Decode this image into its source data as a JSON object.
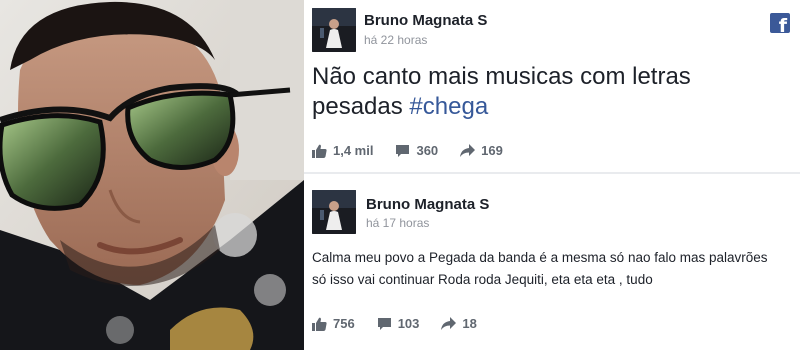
{
  "posts": [
    {
      "author": "Bruno Magnata S",
      "time": "há 22 horas",
      "text": "Não canto mais musicas com letras pesadas",
      "hashtag": "#chega",
      "likes": "1,4 mil",
      "comments": "360",
      "shares": "169"
    },
    {
      "author": "Bruno Magnata S",
      "time": "há 17 horas",
      "text_lines": [
        "Calma meu povo a Pegada da banda é a mesma só nao falo mas palavrões",
        "só isso vai continuar Roda roda Jequiti, eta eta eta , tudo"
      ],
      "likes": "756",
      "comments": "103",
      "shares": "18"
    }
  ],
  "icons": {
    "brand": "facebook-icon",
    "like": "thumbs-up-icon",
    "comment": "comment-icon",
    "share": "share-arrow-icon"
  },
  "colors": {
    "facebook_blue": "#3b5998",
    "hashtag": "#365899",
    "meta_gray": "#90949c",
    "icon_gray": "#606770"
  }
}
